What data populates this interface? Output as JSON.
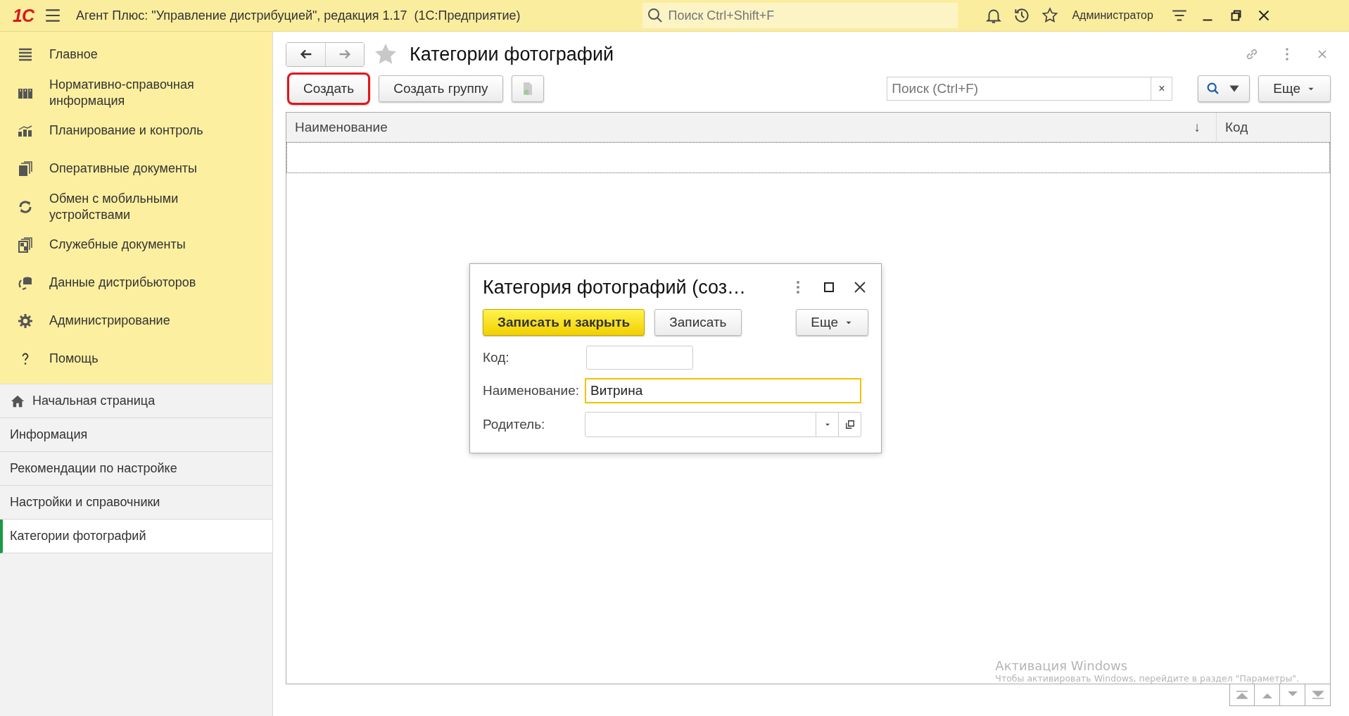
{
  "app_bar": {
    "logo": "1С",
    "title": "Агент Плюс: \"Управление дистрибуцией\", редакция 1.17  (1С:Предприятие)",
    "search": {
      "placeholder": "Поиск Ctrl+Shift+F"
    },
    "user": "Администратор"
  },
  "sections": [
    {
      "label": "Главное"
    },
    {
      "label": "Нормативно-справочная информация"
    },
    {
      "label": "Планирование и контроль"
    },
    {
      "label": "Оперативные документы"
    },
    {
      "label": "Обмен с мобильными устройствами"
    },
    {
      "label": "Служебные документы"
    },
    {
      "label": "Данные дистрибьюторов"
    },
    {
      "label": "Администрирование"
    },
    {
      "label": "Помощь"
    }
  ],
  "open_windows": [
    {
      "label": "Начальная страница",
      "kind": "home",
      "selected": false
    },
    {
      "label": "Информация",
      "kind": "page",
      "selected": false
    },
    {
      "label": "Рекомендации по настройке",
      "kind": "page",
      "selected": false
    },
    {
      "label": "Настройки и справочники",
      "kind": "page",
      "selected": false
    },
    {
      "label": "Категории фотографий",
      "kind": "page",
      "selected": true
    }
  ],
  "form": {
    "title": "Категории фотографий",
    "toolbar": [
      {
        "label": "Создать",
        "highlighted": true
      },
      {
        "label": "Создать группу",
        "highlighted": false
      }
    ],
    "search": {
      "placeholder": "Поиск (Ctrl+F)",
      "clear": "×"
    },
    "more": "Еще",
    "table": {
      "columns": [
        {
          "label": "Наименование",
          "sort": "↓"
        },
        {
          "label": "Код"
        }
      ]
    }
  },
  "dialog": {
    "title": "Категория фотографий (соз…",
    "buttons": [
      {
        "label": "Записать и закрыть",
        "default": true
      },
      {
        "label": "Записать",
        "default": false
      }
    ],
    "more": "Еще",
    "fields": [
      {
        "label": "Код:",
        "kind": "text",
        "focused": false
      },
      {
        "label": "Наименование:",
        "kind": "text",
        "value": "Витрина",
        "focused": true
      },
      {
        "label": "Родитель:",
        "kind": "dropdown",
        "focused": false
      }
    ]
  },
  "os_notice": {
    "title": "Активация Windows",
    "text": "Чтобы активировать Windows, перейдите в раздел \"Параметры\"."
  }
}
